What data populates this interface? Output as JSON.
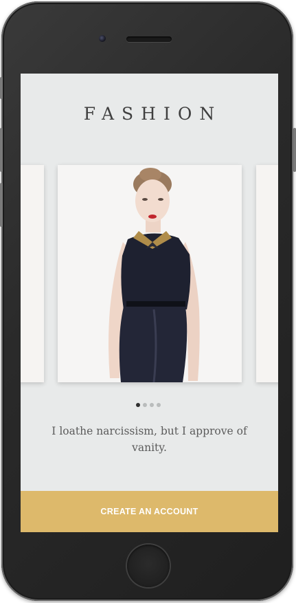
{
  "app": {
    "title": "FASHION",
    "quote": "I loathe narcissism, but I approve of vanity.",
    "cta_label": "CREATE AN ACCOUNT"
  },
  "carousel": {
    "slide_count": 4,
    "active_index": 0,
    "main_image": "woman-in-black-dress-photo"
  },
  "colors": {
    "screen_bg": "#e8eaea",
    "cta_bg": "#ddb96b",
    "cta_text": "#ffffff",
    "title_text": "#3f3f3f",
    "quote_text": "#5b5b5b",
    "dot_active": "#2f2f2f",
    "dot_inactive": "#b9bcbc"
  }
}
